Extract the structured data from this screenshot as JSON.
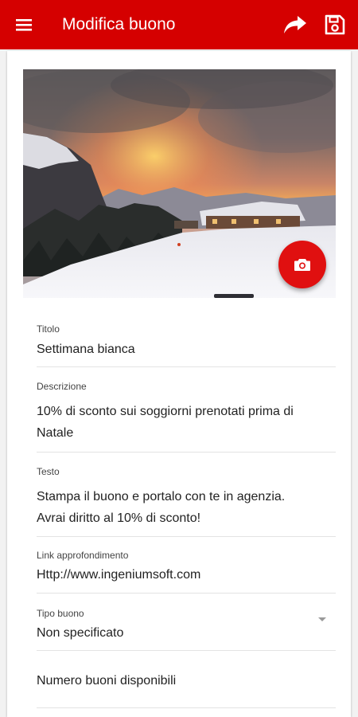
{
  "appbar": {
    "title": "Modifica buono",
    "menu_icon": "hamburger-menu-icon",
    "share_icon": "share-forward-icon",
    "save_icon": "floppy-save-icon",
    "color": "#d50000"
  },
  "photo": {
    "camera_icon": "camera-icon",
    "fab_color": "#e01010"
  },
  "fields": {
    "titolo": {
      "label": "Titolo",
      "value": "Settimana bianca"
    },
    "descrizione": {
      "label": "Descrizione",
      "value_line1": "10% di sconto sui soggiorni prenotati prima di",
      "value_line2": "Natale"
    },
    "testo": {
      "label": "Testo",
      "value_line1": "Stampa il buono e portalo con te in agenzia.",
      "value_line2": "Avrai diritto al 10% di sconto!"
    },
    "link": {
      "label": "Link approfondimento",
      "value": "Http://www.ingeniumsoft.com"
    },
    "tipo": {
      "label": "Tipo buono",
      "value": "Non specificato"
    },
    "numero": {
      "placeholder": "Numero buoni disponibili"
    }
  }
}
